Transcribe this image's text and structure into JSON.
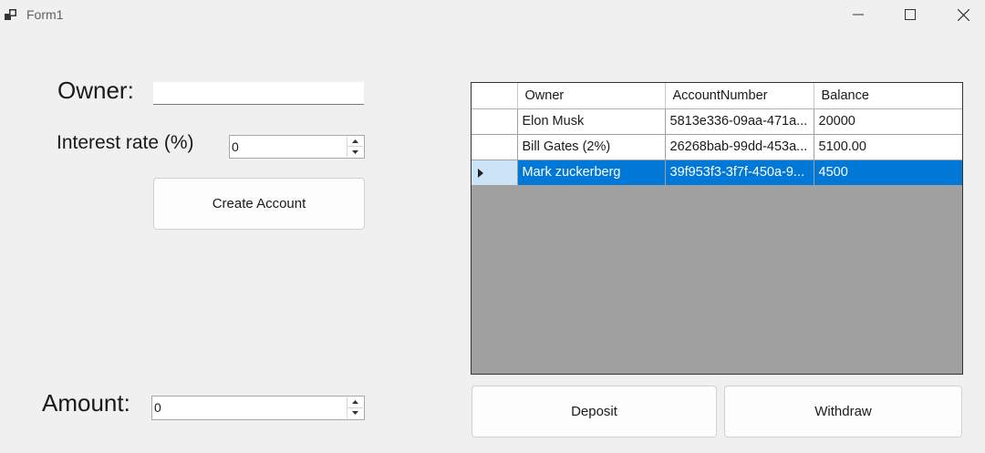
{
  "window": {
    "title": "Form1"
  },
  "form": {
    "owner_label": "Owner:",
    "owner_value": "",
    "interest_label": "Interest rate (%)",
    "interest_value": "0",
    "create_button": "Create Account",
    "amount_label": "Amount:",
    "amount_value": "0",
    "deposit_button": "Deposit",
    "withdraw_button": "Withdraw"
  },
  "grid": {
    "columns": [
      "Owner",
      "AccountNumber",
      "Balance"
    ],
    "rows": [
      {
        "owner": "Elon Musk",
        "account": "5813e336-09aa-471a...",
        "balance": "20000"
      },
      {
        "owner": "Bill Gates (2%)",
        "account": "26268bab-99dd-453a...",
        "balance": "5100.00"
      },
      {
        "owner": "Mark zuckerberg",
        "account": "39f953f3-3f7f-450a-9...",
        "balance": "4500"
      }
    ],
    "selected_row": 2
  },
  "colors": {
    "selection": "#0078d7",
    "grid_background": "#a0a0a0",
    "window": "#f0f0f0"
  },
  "icons": [
    "app-icon",
    "minimize-icon",
    "maximize-icon",
    "close-icon",
    "spin-up-icon",
    "spin-down-icon",
    "row-pointer-icon"
  ]
}
